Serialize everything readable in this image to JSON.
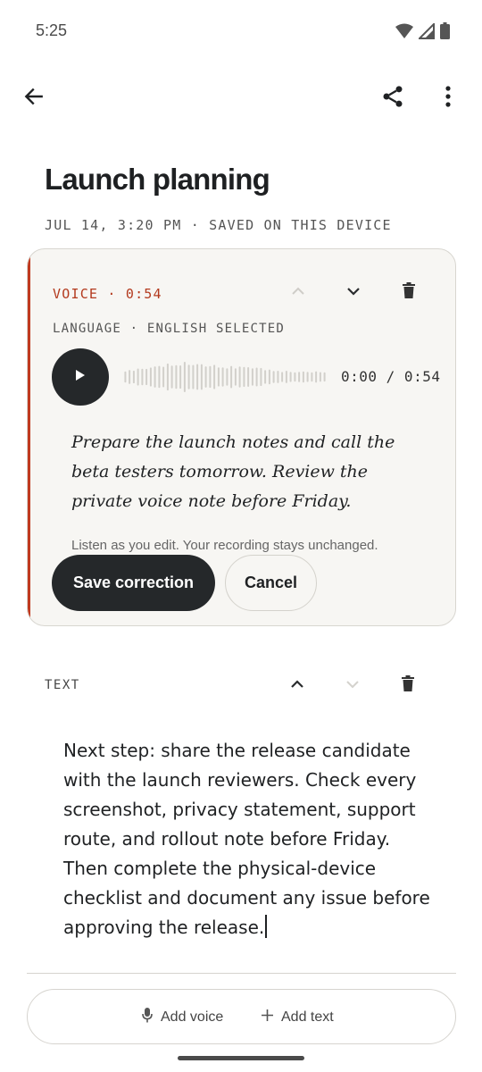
{
  "status_bar": {
    "time": "5:25"
  },
  "note": {
    "title": "Launch planning",
    "meta": "JUL 14, 3:20 PM · SAVED ON THIS DEVICE"
  },
  "voice_block": {
    "label": "VOICE · 0:54",
    "language": "LANGUAGE · ENGLISH SELECTED",
    "time_readout": "0:00 / 0:54",
    "transcript": "Prepare the launch notes and call the beta testers tomorrow. Review the private voice note before Friday.",
    "hint": "Listen as you edit. Your recording stays unchanged.",
    "save_label": "Save correction",
    "cancel_label": "Cancel"
  },
  "text_block": {
    "label": "TEXT",
    "body": "Next step: share the release candidate with the launch reviewers. Check every screenshot, privacy statement, support route, and rollout note before Friday. Then complete the physical-device checklist and document any issue before approving the release."
  },
  "add_bar": {
    "add_voice_label": "Add voice",
    "add_text_label": "Add text"
  },
  "colors": {
    "accent": "#c0391f",
    "dark_button": "#25282a",
    "card_background": "#f7f6f3"
  }
}
